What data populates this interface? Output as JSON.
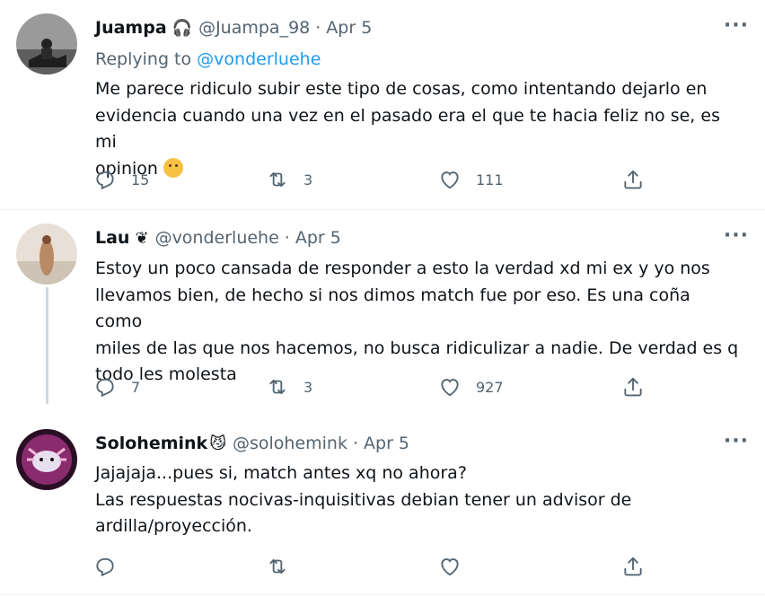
{
  "tweets": [
    {
      "name": "Juampa",
      "badge": "🎧",
      "handle": "@Juampa_98",
      "time": "Apr 5",
      "replying_prefix": "Replying to",
      "replying_mention": "@vonderluehe",
      "text_lines": [
        "Me parece ridiculo subir este tipo de cosas, como intentando dejarlo en",
        "evidencia cuando una vez en el pasado era el que te hacia feliz no se, es mi",
        "opinion"
      ],
      "reply_count": "15",
      "retweet_count": "3",
      "like_count": "111"
    },
    {
      "name": "Lau",
      "badge": "❦",
      "handle": "@vonderluehe",
      "time": "Apr 5",
      "text_lines": [
        "Estoy un poco cansada de responder a esto la verdad xd mi ex y yo nos",
        "llevamos bien, de hecho si nos dimos match fue por eso. Es una coña como",
        "miles de las que nos hacemos, no busca ridiculizar a nadie. De verdad es q",
        "todo les molesta"
      ],
      "reply_count": "7",
      "retweet_count": "3",
      "like_count": "927"
    },
    {
      "name": "Solohemink",
      "badge": "😼",
      "handle": "@solohemink",
      "time": "Apr 5",
      "text_lines": [
        "Jajajaja...pues si, match antes xq no ahora?",
        "Las respuestas nocivas-inquisitivas debian tener un advisor de",
        "ardilla/proyección."
      ],
      "reply_count": "",
      "retweet_count": "",
      "like_count": ""
    }
  ],
  "more_glyph": "···",
  "dot": "·",
  "colors": {
    "muted": "#536471",
    "link": "#1d9bf0",
    "text": "#0f1419"
  }
}
